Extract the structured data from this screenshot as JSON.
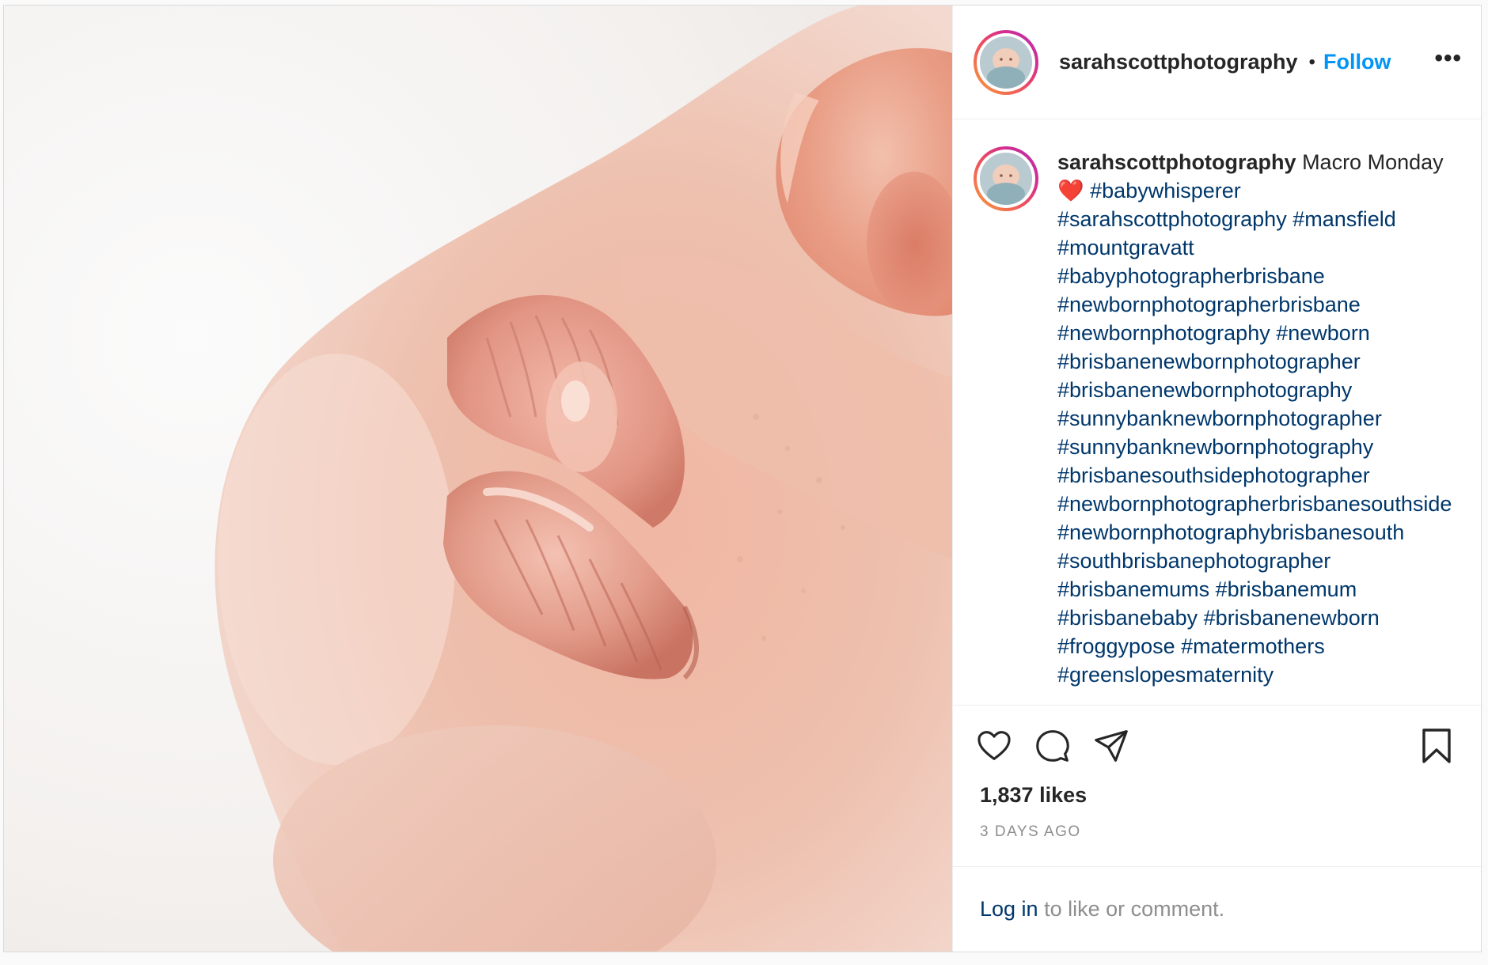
{
  "colors": {
    "link_blue": "#00376b",
    "follow_blue": "#0095f6",
    "text": "#262626",
    "muted": "#8e8e8e",
    "heart": "#e0202f"
  },
  "media": {
    "alt": ""
  },
  "header": {
    "username": "sarahscottphotography",
    "separator": "•",
    "follow_label": "Follow",
    "more_icon": "more-options-icon"
  },
  "caption": {
    "username": "sarahscottphotography",
    "text_before_emoji": "Macro Monday",
    "emoji": "❤️",
    "hashtags": [
      "#babywhisperer",
      "#sarahscottphotography",
      "#mansfield",
      "#mountgravatt",
      "#babyphotographerbrisbane",
      "#newbornphotographerbrisbane",
      "#newbornphotography",
      "#newborn",
      "#brisbanenewbornphotographer",
      "#brisbanenewbornphotography",
      "#sunnybanknewbornphotographer",
      "#sunnybanknewbornphotography",
      "#brisbanesouthsidephotographer",
      "#newbornphotographerbrisbanesouthside",
      "#newbornphotographybrisbanesouth",
      "#southbrisbanephotographer",
      "#brisbanemums",
      "#brisbanemum",
      "#brisbanebaby",
      "#brisbanenewborn",
      "#froggypose",
      "#matermothers",
      "#greenslopesmaternity"
    ]
  },
  "actions": {
    "like_icon": "heart-icon",
    "comment_icon": "comment-icon",
    "share_icon": "paper-plane-icon",
    "save_icon": "bookmark-icon"
  },
  "stats": {
    "likes": "1,837 likes",
    "time_ago": "3 DAYS AGO"
  },
  "login": {
    "link_label": "Log in",
    "rest": " to like or comment."
  }
}
